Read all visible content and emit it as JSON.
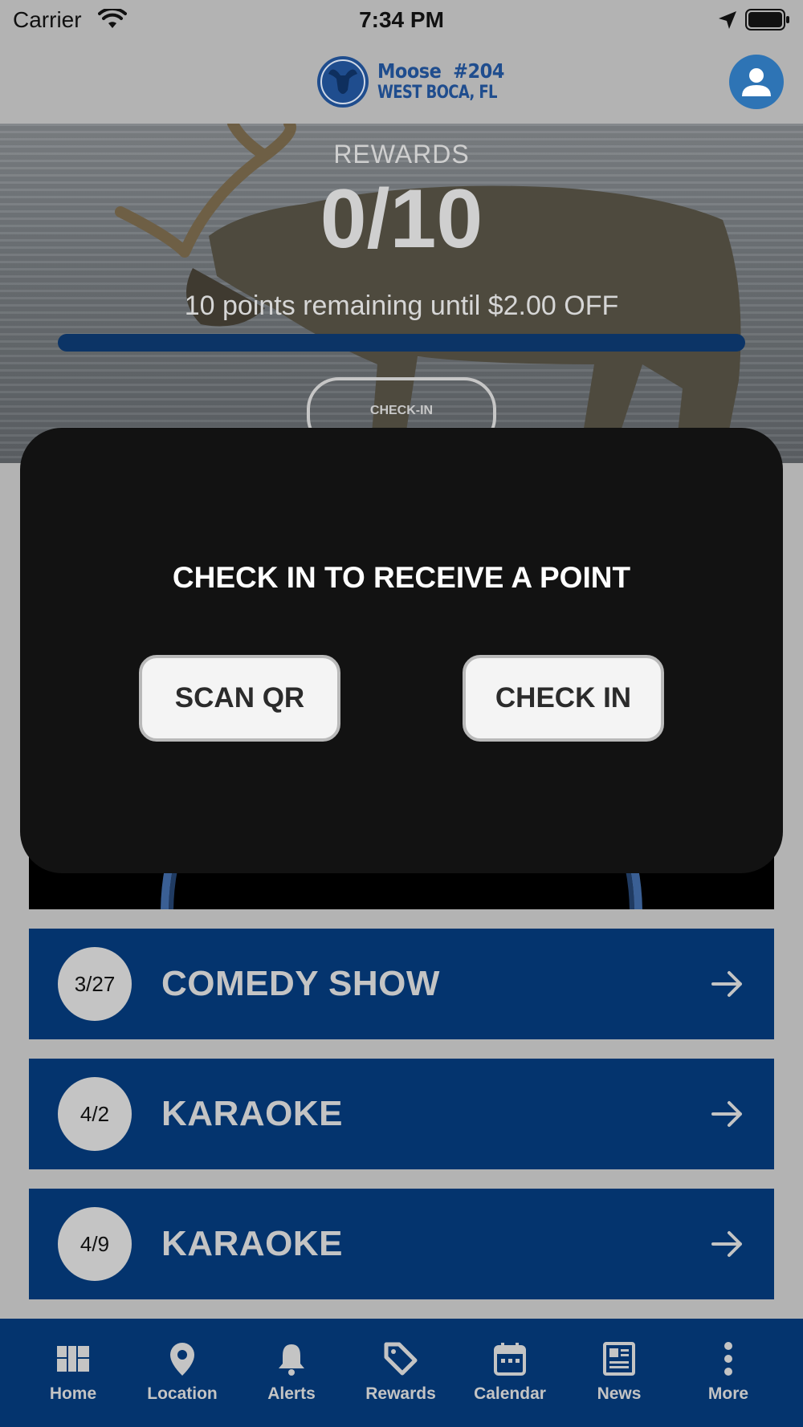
{
  "status_bar": {
    "carrier": "Carrier",
    "time": "7:34 PM"
  },
  "header": {
    "logo_line1": "Moose  #204",
    "logo_line2": "WEST BOCA, FL",
    "avatar_icon": "person-icon"
  },
  "rewards": {
    "label": "REWARDS",
    "count": "0/10",
    "points": 0,
    "goal": 10,
    "remaining_text": "10 points remaining until $2.00 OFF",
    "checkin_button": "CHECK-IN"
  },
  "modal": {
    "title": "CHECK IN TO RECEIVE A POINT",
    "scan_button": "SCAN QR",
    "checkin_button": "CHECK IN"
  },
  "events": [
    {
      "date": "3/27",
      "title": "COMEDY SHOW"
    },
    {
      "date": "4/2",
      "title": "KARAOKE"
    },
    {
      "date": "4/9",
      "title": "KARAOKE"
    }
  ],
  "tabs": [
    {
      "label": "Home",
      "icon": "home-grid-icon"
    },
    {
      "label": "Location",
      "icon": "map-pin-icon"
    },
    {
      "label": "Alerts",
      "icon": "bell-icon"
    },
    {
      "label": "Rewards",
      "icon": "tag-icon"
    },
    {
      "label": "Calendar",
      "icon": "calendar-icon"
    },
    {
      "label": "News",
      "icon": "newspaper-icon"
    },
    {
      "label": "More",
      "icon": "more-vertical-icon"
    }
  ],
  "colors": {
    "brand_blue": "#04346e",
    "accent_blue": "#2e74b5",
    "modal_bg": "#121212"
  }
}
